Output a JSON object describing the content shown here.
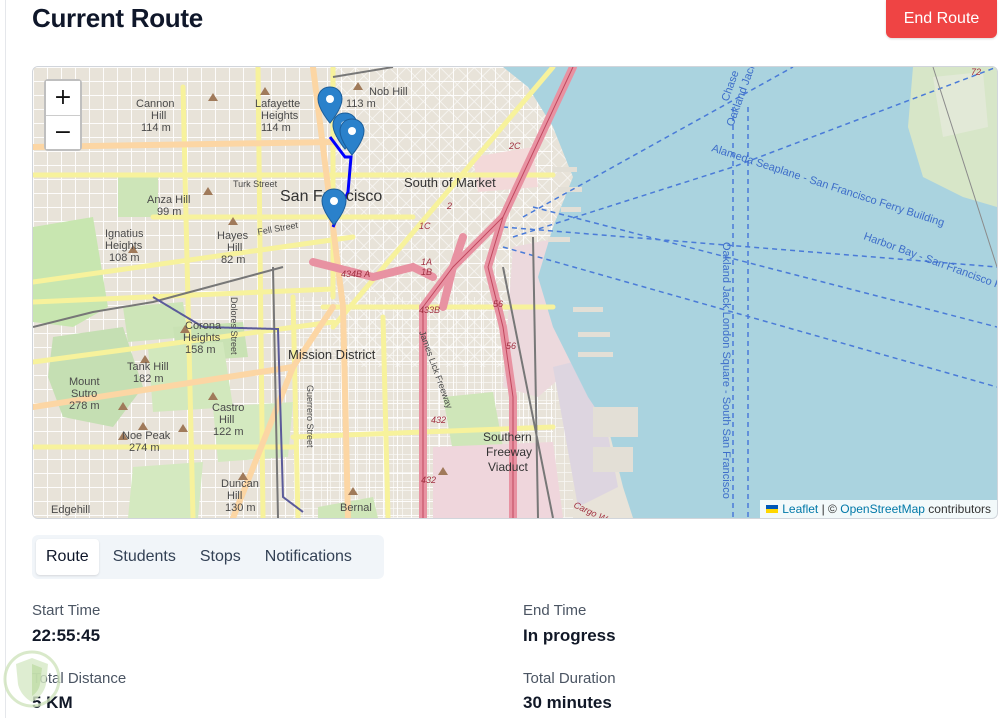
{
  "header": {
    "title": "Current Route",
    "end_route_label": "End Route"
  },
  "map": {
    "zoom_in": "+",
    "zoom_out": "−",
    "attribution": {
      "leaflet": "Leaflet",
      "separator": "| ©",
      "osm": "OpenStreetMap",
      "suffix": "contributors"
    },
    "labels": {
      "cannon_hill": "Cannon",
      "cannon_hill2": "Hill",
      "cannon_h": "114 m",
      "lafayette": "Lafayette",
      "lafayette2": "Heights",
      "lafayette_h": "114 m",
      "nob": "Nob Hill",
      "nob_h": "113 m",
      "sf": "San Francisco",
      "som": "South of Market",
      "turk": "Turk Street",
      "fell": "Fell Street",
      "anza": "Anza Hill",
      "anza_h": "99 m",
      "ignatius": "Ignatius",
      "ignatius2": "Heights",
      "ignatius_h": "108 m",
      "hayes": "Hayes",
      "hayes2": "Hill",
      "hayes_h": "82 m",
      "corona": "Corona",
      "corona2": "Heights",
      "corona_h": "158 m",
      "mission": "Mission District",
      "tank": "Tank Hill",
      "tank_h": "182 m",
      "mount_sutro": "Mount",
      "mount_sutro2": "Sutro",
      "mount_sutro_h": "278 m",
      "castro": "Castro",
      "castro2": "Hill",
      "castro_h": "122 m",
      "noe": "Noe Peak",
      "noe_h": "274 m",
      "duncan": "Duncan",
      "duncan2": "Hill",
      "duncan_h": "130 m",
      "edgehill": "Edgehill",
      "bernal": "Bernal",
      "southern_fwy": "Southern",
      "southern_fwy2": "Freeway",
      "southern_fwy3": "Viaduct",
      "dolores": "Dolores Street",
      "guerrero": "Guerrero Street",
      "james_lick": "James Lick Freeway",
      "alameda": "Alameda Seaplane - San Francisco Ferry Building",
      "harbor_bay": "Harbor Bay - San Francisco F",
      "oakland_jack": "Oakland Jack London Square - South San Francisco",
      "oakland_jack2": "Oakland Jack Lo",
      "chase": "Chase",
      "cargo": "Cargo Way",
      "r2c": "2C",
      "r1c": "1C",
      "r1a": "1A",
      "r1b": "1B",
      "r2": "2",
      "r434": "434B A",
      "r433": "433B",
      "r56": "56",
      "r56b": "56",
      "r432": "432",
      "r432b": "432",
      "r72": "72"
    }
  },
  "tabs": [
    "Route",
    "Students",
    "Stops",
    "Notifications"
  ],
  "info": {
    "start_time_label": "Start Time",
    "start_time": "22:55:45",
    "end_time_label": "End Time",
    "end_time": "In progress",
    "total_distance_label": "Total Distance",
    "total_distance": "5 KM",
    "total_duration_label": "Total Duration",
    "total_duration": "30 minutes"
  },
  "colors": {
    "accent": "#ef4444",
    "water": "#aad3df",
    "route_line": "#0000ff",
    "marker": "#2a81cb"
  }
}
